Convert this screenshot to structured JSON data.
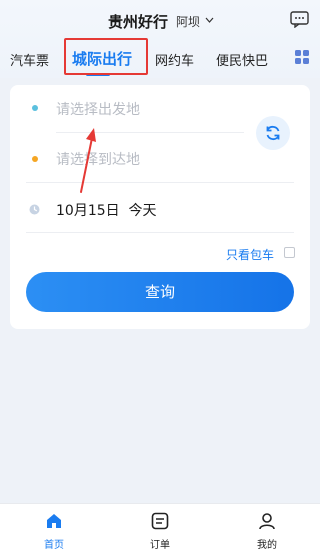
{
  "header": {
    "title": "贵州好行",
    "city": "阿坝",
    "city_chevron_icon": "chevron-down-icon",
    "message_icon": "message-icon"
  },
  "tabs": [
    {
      "label": "汽车票",
      "active": false
    },
    {
      "label": "城际出行",
      "active": true
    },
    {
      "label": "网约车",
      "active": false
    },
    {
      "label": "便民快巴",
      "active": false
    }
  ],
  "more_icon": "grid-icon",
  "colors": {
    "accent": "#1a7cf0",
    "annotation": "#e53935",
    "departure_dot": "#5bc0de",
    "arrival_dot": "#f5a623"
  },
  "search": {
    "departure_placeholder": "请选择出发地",
    "arrival_placeholder": "请选择到达地",
    "date": "10月15日",
    "day_label": "今天",
    "charter_only_label": "只看包车",
    "charter_only_checked": false,
    "query_button": "查询"
  },
  "bottom_nav": [
    {
      "label": "首页",
      "icon": "home-icon",
      "active": true
    },
    {
      "label": "订单",
      "icon": "order-icon",
      "active": false
    },
    {
      "label": "我的",
      "icon": "profile-icon",
      "active": false
    }
  ]
}
